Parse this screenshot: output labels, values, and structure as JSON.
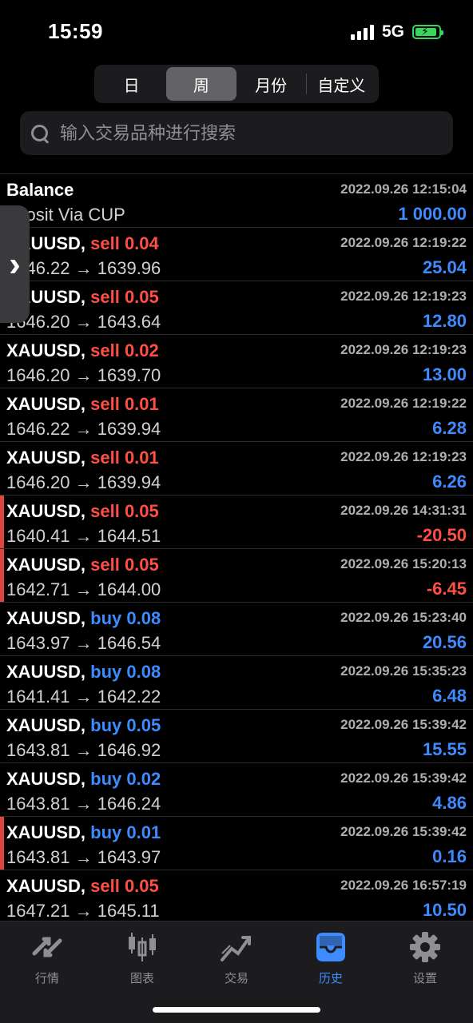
{
  "status_bar": {
    "time": "15:59",
    "network": "5G"
  },
  "period_tabs": [
    {
      "label": "日",
      "active": false
    },
    {
      "label": "周",
      "active": true
    },
    {
      "label": "月份",
      "active": false
    },
    {
      "label": "自定义",
      "active": false
    }
  ],
  "search": {
    "placeholder": "输入交易品种进行搜索"
  },
  "rows": [
    {
      "symbol": "Balance",
      "action": "",
      "detail": "eposit Via CUP",
      "datetime": "2022.09.26 12:15:04",
      "amount": "1 000.00",
      "amount_sign": "pos",
      "marked": false
    },
    {
      "symbol": "XAUUSD,",
      "action": "sell 0.04",
      "side": "sell",
      "detail": "1646.22 → 1639.96",
      "datetime": "2022.09.26 12:19:22",
      "amount": "25.04",
      "amount_sign": "pos",
      "marked": false
    },
    {
      "symbol": "XAUUSD,",
      "action": "sell 0.05",
      "side": "sell",
      "detail": "1646.20 → 1643.64",
      "datetime": "2022.09.26 12:19:23",
      "amount": "12.80",
      "amount_sign": "pos",
      "marked": false
    },
    {
      "symbol": "XAUUSD,",
      "action": "sell 0.02",
      "side": "sell",
      "detail": "1646.20 → 1639.70",
      "datetime": "2022.09.26 12:19:23",
      "amount": "13.00",
      "amount_sign": "pos",
      "marked": false
    },
    {
      "symbol": "XAUUSD,",
      "action": "sell 0.01",
      "side": "sell",
      "detail": "1646.22 → 1639.94",
      "datetime": "2022.09.26 12:19:22",
      "amount": "6.28",
      "amount_sign": "pos",
      "marked": false
    },
    {
      "symbol": "XAUUSD,",
      "action": "sell 0.01",
      "side": "sell",
      "detail": "1646.20 → 1639.94",
      "datetime": "2022.09.26 12:19:23",
      "amount": "6.26",
      "amount_sign": "pos",
      "marked": false
    },
    {
      "symbol": "XAUUSD,",
      "action": "sell 0.05",
      "side": "sell",
      "detail": "1640.41 → 1644.51",
      "datetime": "2022.09.26 14:31:31",
      "amount": "-20.50",
      "amount_sign": "neg",
      "marked": true
    },
    {
      "symbol": "XAUUSD,",
      "action": "sell 0.05",
      "side": "sell",
      "detail": "1642.71 → 1644.00",
      "datetime": "2022.09.26 15:20:13",
      "amount": "-6.45",
      "amount_sign": "neg",
      "marked": true
    },
    {
      "symbol": "XAUUSD,",
      "action": "buy 0.08",
      "side": "buy",
      "detail": "1643.97 → 1646.54",
      "datetime": "2022.09.26 15:23:40",
      "amount": "20.56",
      "amount_sign": "pos",
      "marked": false
    },
    {
      "symbol": "XAUUSD,",
      "action": "buy 0.08",
      "side": "buy",
      "detail": "1641.41 → 1642.22",
      "datetime": "2022.09.26 15:35:23",
      "amount": "6.48",
      "amount_sign": "pos",
      "marked": false
    },
    {
      "symbol": "XAUUSD,",
      "action": "buy 0.05",
      "side": "buy",
      "detail": "1643.81 → 1646.92",
      "datetime": "2022.09.26 15:39:42",
      "amount": "15.55",
      "amount_sign": "pos",
      "marked": false
    },
    {
      "symbol": "XAUUSD,",
      "action": "buy 0.02",
      "side": "buy",
      "detail": "1643.81 → 1646.24",
      "datetime": "2022.09.26 15:39:42",
      "amount": "4.86",
      "amount_sign": "pos",
      "marked": false
    },
    {
      "symbol": "XAUUSD,",
      "action": "buy 0.01",
      "side": "buy",
      "detail": "1643.81 → 1643.97",
      "datetime": "2022.09.26 15:39:42",
      "amount": "0.16",
      "amount_sign": "pos",
      "marked": true
    },
    {
      "symbol": "XAUUSD,",
      "action": "sell 0.05",
      "side": "sell",
      "detail": "1647.21 → 1645.11",
      "datetime": "2022.09.26 16:57:19",
      "amount": "10.50",
      "amount_sign": "pos",
      "marked": false
    }
  ],
  "tabbar": [
    {
      "label": "行情",
      "icon": "quotes-icon",
      "active": false
    },
    {
      "label": "图表",
      "icon": "chart-icon",
      "active": false
    },
    {
      "label": "交易",
      "icon": "trade-icon",
      "active": false
    },
    {
      "label": "历史",
      "icon": "history-icon",
      "active": true
    },
    {
      "label": "设置",
      "icon": "gear-icon",
      "active": false
    }
  ],
  "colors": {
    "sell": "#ff4f44",
    "buy": "#3d8bff",
    "profit": "#3d8bff",
    "loss": "#ff4f44",
    "active_tab": "#3d8bff"
  }
}
